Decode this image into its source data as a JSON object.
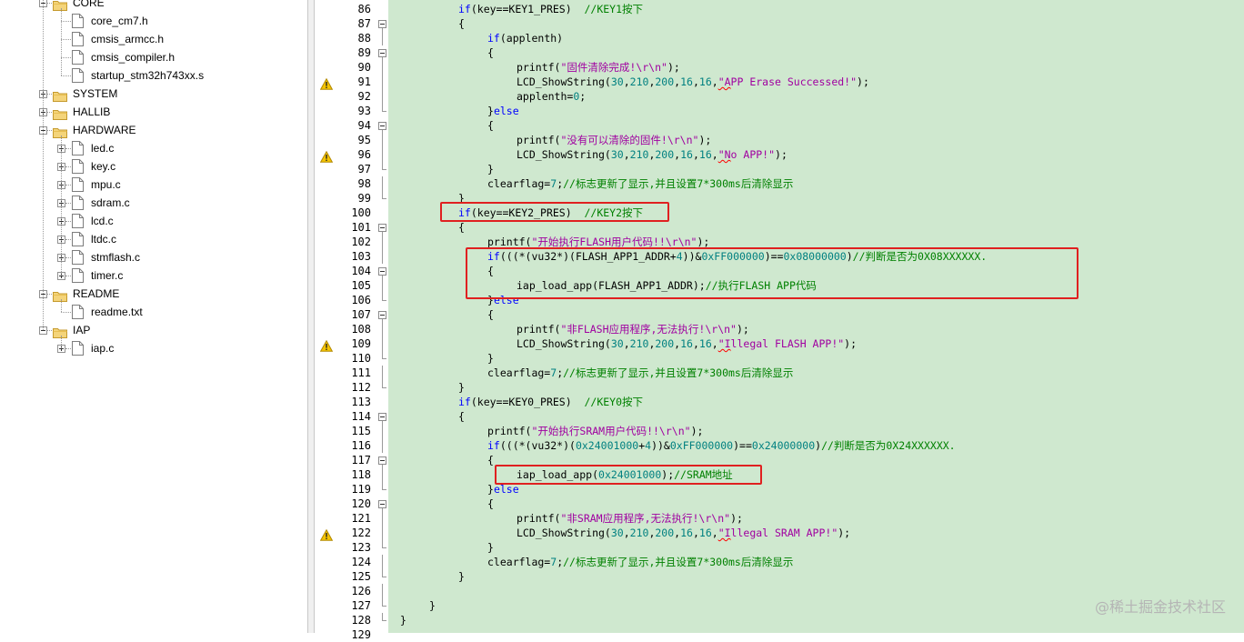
{
  "project_tree": {
    "items": [
      {
        "label": "CORE",
        "kind": "folder",
        "state": "expanded"
      },
      {
        "label": "core_cm7.h",
        "kind": "file"
      },
      {
        "label": "cmsis_armcc.h",
        "kind": "file"
      },
      {
        "label": "cmsis_compiler.h",
        "kind": "file"
      },
      {
        "label": "startup_stm32h743xx.s",
        "kind": "file"
      },
      {
        "label": "SYSTEM",
        "kind": "folder",
        "state": "collapsed"
      },
      {
        "label": "HALLIB",
        "kind": "folder",
        "state": "collapsed"
      },
      {
        "label": "HARDWARE",
        "kind": "folder",
        "state": "expanded"
      },
      {
        "label": "led.c",
        "kind": "file"
      },
      {
        "label": "key.c",
        "kind": "file"
      },
      {
        "label": "mpu.c",
        "kind": "file"
      },
      {
        "label": "sdram.c",
        "kind": "file"
      },
      {
        "label": "lcd.c",
        "kind": "file"
      },
      {
        "label": "ltdc.c",
        "kind": "file"
      },
      {
        "label": "stmflash.c",
        "kind": "file"
      },
      {
        "label": "timer.c",
        "kind": "file"
      },
      {
        "label": "README",
        "kind": "folder",
        "state": "expanded"
      },
      {
        "label": "readme.txt",
        "kind": "file"
      },
      {
        "label": "IAP",
        "kind": "folder",
        "state": "expanded"
      },
      {
        "label": "iap.c",
        "kind": "file"
      }
    ]
  },
  "editor": {
    "lines": [
      {
        "n": "86",
        "fold": "none",
        "warn": false,
        "indent": 2,
        "tokens": [
          [
            "kw",
            "if"
          ],
          [
            "",
            "(key==KEY1_PRES)  "
          ],
          [
            "cm",
            "//KEY1按下"
          ]
        ]
      },
      {
        "n": "87",
        "fold": "box",
        "warn": false,
        "indent": 2,
        "tokens": [
          [
            "",
            "{"
          ]
        ]
      },
      {
        "n": "88",
        "fold": "line",
        "warn": false,
        "indent": 3,
        "tokens": [
          [
            "kw",
            "if"
          ],
          [
            "",
            "(applenth)"
          ]
        ]
      },
      {
        "n": "89",
        "fold": "box",
        "warn": false,
        "indent": 3,
        "tokens": [
          [
            "",
            "{"
          ]
        ]
      },
      {
        "n": "90",
        "fold": "line",
        "warn": false,
        "indent": 4,
        "tokens": [
          [
            "",
            "printf("
          ],
          [
            "str",
            "\"固件清除完成!\\r\\n\""
          ],
          [
            "",
            ");"
          ]
        ]
      },
      {
        "n": "91",
        "fold": "line",
        "warn": true,
        "indent": 4,
        "tokens": [
          [
            "",
            "LCD_ShowString("
          ],
          [
            "num",
            "30"
          ],
          [
            "",
            ","
          ],
          [
            "num",
            "210"
          ],
          [
            "",
            ","
          ],
          [
            "num",
            "200"
          ],
          [
            "",
            ","
          ],
          [
            "num",
            "16"
          ],
          [
            "",
            ","
          ],
          [
            "num",
            "16"
          ],
          [
            "",
            ","
          ],
          [
            "str squig",
            "\"A"
          ],
          [
            "str",
            "PP Erase Successed!\""
          ],
          [
            "",
            ");"
          ]
        ]
      },
      {
        "n": "92",
        "fold": "line",
        "warn": false,
        "indent": 4,
        "tokens": [
          [
            "",
            "applenth="
          ],
          [
            "num",
            "0"
          ],
          [
            "",
            ";"
          ]
        ]
      },
      {
        "n": "93",
        "fold": "tick",
        "warn": false,
        "indent": 3,
        "tokens": [
          [
            "",
            "}"
          ],
          [
            "kw",
            "else"
          ]
        ]
      },
      {
        "n": "94",
        "fold": "box",
        "warn": false,
        "indent": 3,
        "tokens": [
          [
            "",
            "{"
          ]
        ]
      },
      {
        "n": "95",
        "fold": "line",
        "warn": false,
        "indent": 4,
        "tokens": [
          [
            "",
            "printf("
          ],
          [
            "str",
            "\"没有可以清除的固件!\\r\\n\""
          ],
          [
            "",
            ");"
          ]
        ]
      },
      {
        "n": "96",
        "fold": "line",
        "warn": true,
        "indent": 4,
        "tokens": [
          [
            "",
            "LCD_ShowString("
          ],
          [
            "num",
            "30"
          ],
          [
            "",
            ","
          ],
          [
            "num",
            "210"
          ],
          [
            "",
            ","
          ],
          [
            "num",
            "200"
          ],
          [
            "",
            ","
          ],
          [
            "num",
            "16"
          ],
          [
            "",
            ","
          ],
          [
            "num",
            "16"
          ],
          [
            "",
            ","
          ],
          [
            "str squig",
            "\"N"
          ],
          [
            "str",
            "o APP!\""
          ],
          [
            "",
            ");"
          ]
        ]
      },
      {
        "n": "97",
        "fold": "tick",
        "warn": false,
        "indent": 3,
        "tokens": [
          [
            "",
            "}"
          ]
        ]
      },
      {
        "n": "98",
        "fold": "line",
        "warn": false,
        "indent": 3,
        "tokens": [
          [
            "",
            "clearflag="
          ],
          [
            "num",
            "7"
          ],
          [
            "",
            ";"
          ],
          [
            "cm",
            "//标志更新了显示,并且设置7*300ms后清除显示"
          ]
        ]
      },
      {
        "n": "99",
        "fold": "tick",
        "warn": false,
        "indent": 2,
        "tokens": [
          [
            "",
            "}"
          ]
        ]
      },
      {
        "n": "100",
        "fold": "none",
        "warn": false,
        "indent": 2,
        "tokens": [
          [
            "kw",
            "if"
          ],
          [
            "",
            "(key==KEY2_PRES)  "
          ],
          [
            "cm",
            "//KEY2按下"
          ]
        ]
      },
      {
        "n": "101",
        "fold": "box",
        "warn": false,
        "indent": 2,
        "tokens": [
          [
            "",
            "{"
          ]
        ]
      },
      {
        "n": "102",
        "fold": "line",
        "warn": false,
        "indent": 3,
        "tokens": [
          [
            "",
            "printf("
          ],
          [
            "str",
            "\"开始执行FLASH用户代码!!\\r\\n\""
          ],
          [
            "",
            ");"
          ]
        ]
      },
      {
        "n": "103",
        "fold": "line",
        "warn": false,
        "indent": 3,
        "tokens": [
          [
            "kw",
            "if"
          ],
          [
            "",
            "(((*(vu32*)(FLASH_APP1_ADDR+"
          ],
          [
            "num",
            "4"
          ],
          [
            "",
            "))&"
          ],
          [
            "num",
            "0xFF000000"
          ],
          [
            "",
            ")=="
          ],
          [
            "num",
            "0x08000000"
          ],
          [
            "",
            ")"
          ],
          [
            "cm",
            "//判断是否为0X08XXXXXX."
          ]
        ]
      },
      {
        "n": "104",
        "fold": "box",
        "warn": false,
        "indent": 3,
        "tokens": [
          [
            "",
            "{"
          ]
        ]
      },
      {
        "n": "105",
        "fold": "line",
        "warn": false,
        "indent": 4,
        "tokens": [
          [
            "",
            "iap_load_app(FLASH_APP1_ADDR);"
          ],
          [
            "cm",
            "//执行FLASH APP代码"
          ]
        ]
      },
      {
        "n": "106",
        "fold": "tick",
        "warn": false,
        "indent": 3,
        "tokens": [
          [
            "",
            "}"
          ],
          [
            "kw",
            "else"
          ]
        ]
      },
      {
        "n": "107",
        "fold": "box",
        "warn": false,
        "indent": 3,
        "tokens": [
          [
            "",
            "{"
          ]
        ]
      },
      {
        "n": "108",
        "fold": "line",
        "warn": false,
        "indent": 4,
        "tokens": [
          [
            "",
            "printf("
          ],
          [
            "str",
            "\"非FLASH应用程序,无法执行!\\r\\n\""
          ],
          [
            "",
            ");"
          ]
        ]
      },
      {
        "n": "109",
        "fold": "line",
        "warn": true,
        "indent": 4,
        "tokens": [
          [
            "",
            "LCD_ShowString("
          ],
          [
            "num",
            "30"
          ],
          [
            "",
            ","
          ],
          [
            "num",
            "210"
          ],
          [
            "",
            ","
          ],
          [
            "num",
            "200"
          ],
          [
            "",
            ","
          ],
          [
            "num",
            "16"
          ],
          [
            "",
            ","
          ],
          [
            "num",
            "16"
          ],
          [
            "",
            ","
          ],
          [
            "str squig",
            "\"I"
          ],
          [
            "str",
            "llegal FLASH APP!\""
          ],
          [
            "",
            ");"
          ]
        ]
      },
      {
        "n": "110",
        "fold": "tick",
        "warn": false,
        "indent": 3,
        "tokens": [
          [
            "",
            "}"
          ]
        ]
      },
      {
        "n": "111",
        "fold": "line",
        "warn": false,
        "indent": 3,
        "tokens": [
          [
            "",
            "clearflag="
          ],
          [
            "num",
            "7"
          ],
          [
            "",
            ";"
          ],
          [
            "cm",
            "//标志更新了显示,并且设置7*300ms后清除显示"
          ]
        ]
      },
      {
        "n": "112",
        "fold": "tick",
        "warn": false,
        "indent": 2,
        "tokens": [
          [
            "",
            "}"
          ]
        ]
      },
      {
        "n": "113",
        "fold": "none",
        "warn": false,
        "indent": 2,
        "tokens": [
          [
            "kw",
            "if"
          ],
          [
            "",
            "(key==KEY0_PRES)  "
          ],
          [
            "cm",
            "//KEY0按下"
          ]
        ]
      },
      {
        "n": "114",
        "fold": "box",
        "warn": false,
        "indent": 2,
        "tokens": [
          [
            "",
            "{"
          ]
        ]
      },
      {
        "n": "115",
        "fold": "line",
        "warn": false,
        "indent": 3,
        "tokens": [
          [
            "",
            "printf("
          ],
          [
            "str",
            "\"开始执行SRAM用户代码!!\\r\\n\""
          ],
          [
            "",
            ");"
          ]
        ]
      },
      {
        "n": "116",
        "fold": "line",
        "warn": false,
        "indent": 3,
        "tokens": [
          [
            "kw",
            "if"
          ],
          [
            "",
            "(((*(vu32*)("
          ],
          [
            "num",
            "0x24001000"
          ],
          [
            "",
            "+"
          ],
          [
            "num",
            "4"
          ],
          [
            "",
            "))&"
          ],
          [
            "num",
            "0xFF000000"
          ],
          [
            "",
            ")=="
          ],
          [
            "num",
            "0x24000000"
          ],
          [
            "",
            ")"
          ],
          [
            "cm",
            "//判断是否为0X24XXXXXX."
          ]
        ]
      },
      {
        "n": "117",
        "fold": "box",
        "warn": false,
        "indent": 3,
        "tokens": [
          [
            "",
            "{"
          ]
        ]
      },
      {
        "n": "118",
        "fold": "line",
        "warn": false,
        "indent": 4,
        "tokens": [
          [
            "",
            "iap_load_app("
          ],
          [
            "num",
            "0x24001000"
          ],
          [
            "",
            ");"
          ],
          [
            "cm",
            "//SRAM地址"
          ]
        ]
      },
      {
        "n": "119",
        "fold": "tick",
        "warn": false,
        "indent": 3,
        "tokens": [
          [
            "",
            "}"
          ],
          [
            "kw",
            "else"
          ]
        ]
      },
      {
        "n": "120",
        "fold": "box",
        "warn": false,
        "indent": 3,
        "tokens": [
          [
            "",
            "{"
          ]
        ]
      },
      {
        "n": "121",
        "fold": "line",
        "warn": false,
        "indent": 4,
        "tokens": [
          [
            "",
            "printf("
          ],
          [
            "str",
            "\"非SRAM应用程序,无法执行!\\r\\n\""
          ],
          [
            "",
            ");"
          ]
        ]
      },
      {
        "n": "122",
        "fold": "line",
        "warn": true,
        "indent": 4,
        "tokens": [
          [
            "",
            "LCD_ShowString("
          ],
          [
            "num",
            "30"
          ],
          [
            "",
            ","
          ],
          [
            "num",
            "210"
          ],
          [
            "",
            ","
          ],
          [
            "num",
            "200"
          ],
          [
            "",
            ","
          ],
          [
            "num",
            "16"
          ],
          [
            "",
            ","
          ],
          [
            "num",
            "16"
          ],
          [
            "",
            ","
          ],
          [
            "str squig",
            "\"I"
          ],
          [
            "str",
            "llegal SRAM APP!\""
          ],
          [
            "",
            ");"
          ]
        ]
      },
      {
        "n": "123",
        "fold": "tick",
        "warn": false,
        "indent": 3,
        "tokens": [
          [
            "",
            "}"
          ]
        ]
      },
      {
        "n": "124",
        "fold": "line",
        "warn": false,
        "indent": 3,
        "tokens": [
          [
            "",
            "clearflag="
          ],
          [
            "num",
            "7"
          ],
          [
            "",
            ";"
          ],
          [
            "cm",
            "//标志更新了显示,并且设置7*300ms后清除显示"
          ]
        ]
      },
      {
        "n": "125",
        "fold": "tick",
        "warn": false,
        "indent": 2,
        "tokens": [
          [
            "",
            "}"
          ]
        ]
      },
      {
        "n": "126",
        "fold": "line",
        "warn": false,
        "indent": 0,
        "tokens": []
      },
      {
        "n": "127",
        "fold": "tick",
        "warn": false,
        "indent": 1,
        "tokens": [
          [
            "",
            "}"
          ]
        ]
      },
      {
        "n": "128",
        "fold": "tick",
        "warn": false,
        "indent": 0,
        "tokens": [
          [
            "",
            "}"
          ]
        ]
      },
      {
        "n": "129",
        "fold": "none",
        "warn": false,
        "indent": 0,
        "tokens": []
      }
    ]
  },
  "watermark": "@稀土掘金技术社区",
  "colors": {
    "code_background": "#cfe8cf",
    "keyword": "#0000ff",
    "string": "#a000a0",
    "number": "#008080",
    "comment": "#008000",
    "highlight_box": "#e02020"
  },
  "icons": {
    "warning": "warning-triangle-icon",
    "folder": "folder-icon",
    "file": "file-icon"
  }
}
